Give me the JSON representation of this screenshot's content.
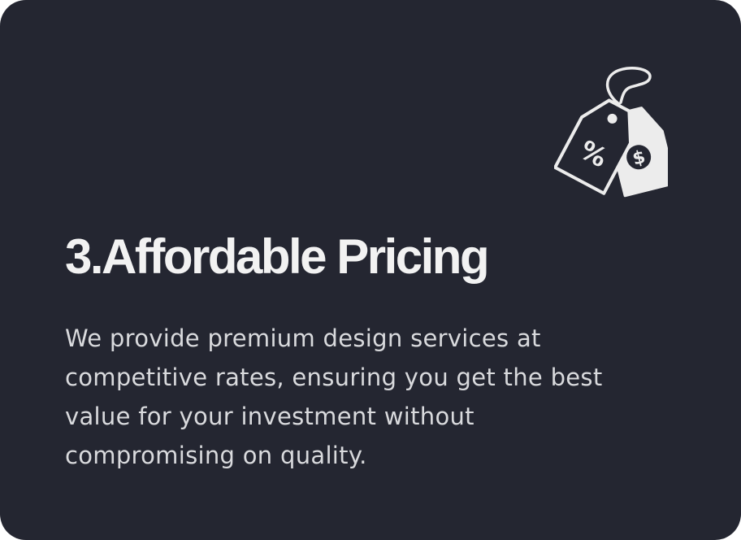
{
  "card": {
    "icon": "price-tags-icon",
    "percent_symbol": "%",
    "dollar_symbol": "$",
    "title": "3.Affordable Pricing",
    "description_lines": [
      "We provide premium design services at",
      "competitive rates, ensuring you get the best",
      "value for your investment without",
      "compromising on quality."
    ]
  },
  "colors": {
    "background": "#242631",
    "text": "#f2f2f2",
    "muted_text": "#d9dadd"
  }
}
